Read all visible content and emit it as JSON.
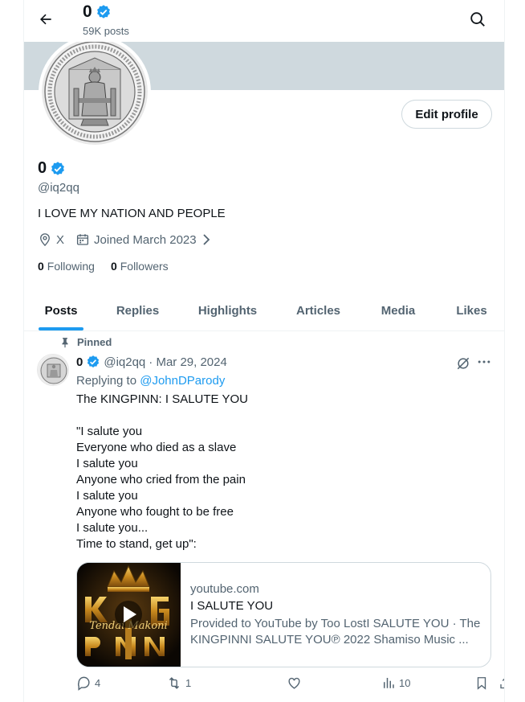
{
  "header": {
    "name": "0",
    "posts_count": "59K posts"
  },
  "profile": {
    "name": "0",
    "handle": "@iq2qq",
    "bio": "I LOVE MY NATION AND PEOPLE",
    "location": "X",
    "joined": "Joined March 2023",
    "following_count": "0",
    "following_label": "Following",
    "followers_count": "0",
    "followers_label": "Followers",
    "edit_label": "Edit profile"
  },
  "tabs": [
    {
      "label": "Posts",
      "active": true
    },
    {
      "label": "Replies"
    },
    {
      "label": "Highlights"
    },
    {
      "label": "Articles"
    },
    {
      "label": "Media"
    },
    {
      "label": "Likes"
    }
  ],
  "post": {
    "pinned_label": "Pinned",
    "name": "0",
    "handle": "@iq2qq",
    "date": "· Mar 29, 2024",
    "replying_prefix": "Replying to",
    "replying_handle": "@JohnDParody",
    "lines": [
      "The KINGPINN: I SALUTE YOU",
      "",
      "\"I salute you",
      "Everyone who died as a slave",
      "I salute you",
      "Anyone who cried from the pain",
      "I salute you",
      "Anyone who fought to be free",
      "I salute you...",
      "Time to stand, get up\":"
    ],
    "card": {
      "domain": "youtube.com",
      "title": "I SALUTE YOU",
      "desc_line1": "Provided to YouTube by Too LostI SALUTE YOU · The",
      "desc_line2": "KINGPINNI SALUTE YOU℗ 2022 Shamiso Music ..."
    },
    "actions": {
      "replies": "4",
      "reposts": "1",
      "likes": "",
      "views": "10"
    }
  },
  "colors": {
    "accent": "#1d9bf0",
    "banner": "#cfd9de",
    "muted": "#536471"
  }
}
